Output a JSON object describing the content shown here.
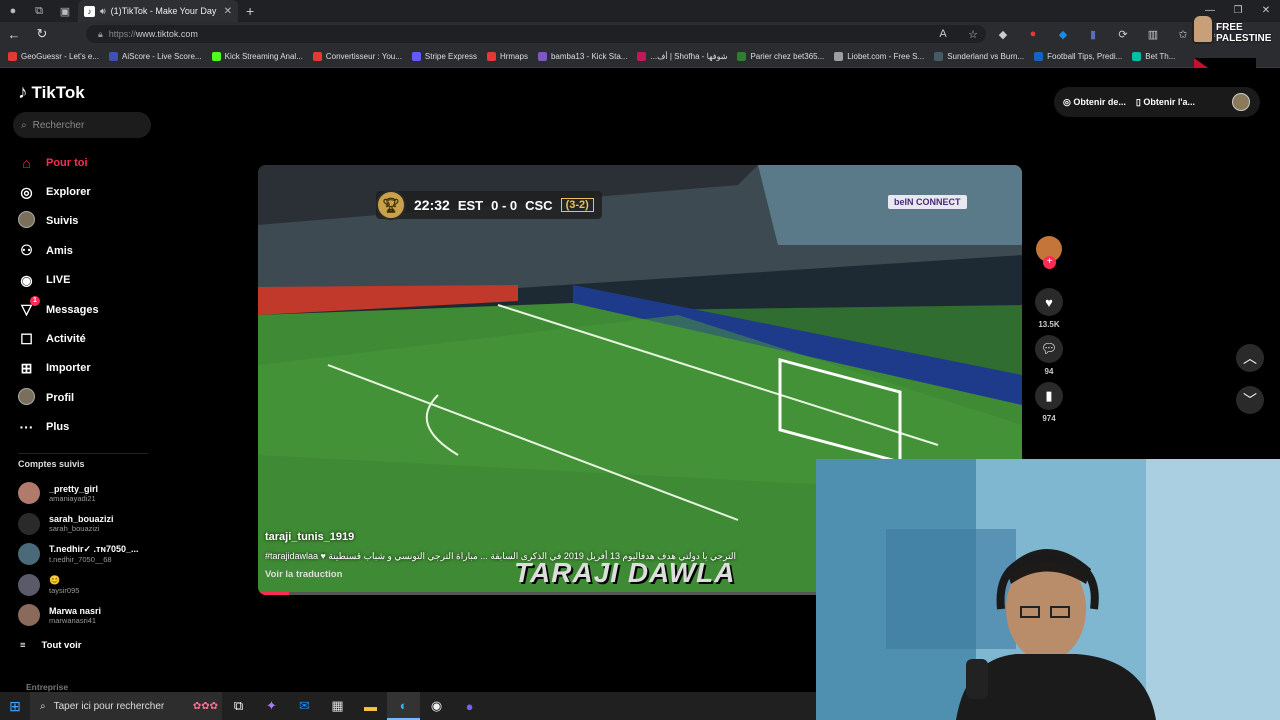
{
  "browser": {
    "tab_title": "(1)TikTok - Make Your Day",
    "url_prefix": "https://",
    "url": "www.tiktok.com",
    "bookmarks": [
      {
        "label": "GeoGuessr - Let's e...",
        "color": "#e53935"
      },
      {
        "label": "AiScore - Live Score...",
        "color": "#3f51b5"
      },
      {
        "label": "Kick Streaming Anal...",
        "color": "#53fc18"
      },
      {
        "label": "Convertisseur : You...",
        "color": "#e53935"
      },
      {
        "label": "Stripe Express",
        "color": "#635bff"
      },
      {
        "label": "Hrmaps",
        "color": "#e53935"
      },
      {
        "label": "bamba13 - Kick Sta...",
        "color": "#7e57c2"
      },
      {
        "label": "...أف | Shofha - شوفها",
        "color": "#c2185b"
      },
      {
        "label": "Parier chez bet365...",
        "color": "#2e7d32"
      },
      {
        "label": "Liobet.com - Free S...",
        "color": "#9e9e9e"
      },
      {
        "label": "Sunderland vs Burn...",
        "color": "#455a64"
      },
      {
        "label": "Football Tips, Predi...",
        "color": "#1565c0"
      },
      {
        "label": "Bet Th...",
        "color": "#00bfa5"
      }
    ],
    "overlay_text": "FREE PALESTINE"
  },
  "tiktok": {
    "logo": "TikTok",
    "search_placeholder": "Rechercher",
    "menu": [
      {
        "label": "Pour toi",
        "icon": "home-icon",
        "active": true
      },
      {
        "label": "Explorer",
        "icon": "compass-icon"
      },
      {
        "label": "Suivis",
        "icon": "avatar"
      },
      {
        "label": "Amis",
        "icon": "friends-icon"
      },
      {
        "label": "LIVE",
        "icon": "live-icon"
      },
      {
        "label": "Messages",
        "icon": "messages-icon",
        "badge": "1"
      },
      {
        "label": "Activité",
        "icon": "activity-icon"
      },
      {
        "label": "Importer",
        "icon": "upload-icon"
      },
      {
        "label": "Profil",
        "icon": "avatar"
      },
      {
        "label": "Plus",
        "icon": "more-icon"
      }
    ],
    "followed_header": "Comptes suivis",
    "followed": [
      {
        "name": "_pretty_girl",
        "handle": "amaniayadi21",
        "color": "#b07b6a"
      },
      {
        "name": "sarah_bouazizi",
        "handle": "sarah_bouazizi",
        "color": "#2a2a2a"
      },
      {
        "name": "T.nedhir✓ .тɴ7050_...",
        "handle": "t.nedhir_7050__68",
        "color": "#4a6a7a"
      },
      {
        "name": "😊",
        "handle": "taysir095",
        "color": "#5a5a6a"
      },
      {
        "name": "Marwa nasri",
        "handle": "marwanasri41",
        "color": "#8a6a5a"
      }
    ],
    "see_all": "Tout voir",
    "entreprise": "Entreprise",
    "get_app": "Obtenir de...",
    "get_app2": "Obtenir l'a..."
  },
  "video": {
    "scoreboard": {
      "clock": "22:32",
      "home": "EST",
      "score": "0 - 0",
      "away": "CSC",
      "aggregate": "(3-2)"
    },
    "broadcaster": "beIN CONNECT",
    "author": "taraji_tunis_1919",
    "description": "#tarajidawlaa ♥ الترجي يا دولتي هدف هدفاليوم 13 أفريل 2019 في الذكرى السابقة ... مباراة الترجي التونسي و شباب قسنطينة",
    "translate": "Voir la traduction",
    "watermark": "TARAJI DAWLA",
    "progress": 0.04
  },
  "actions": {
    "likes": "13.5K",
    "comments": "94",
    "saves": "974"
  },
  "taskbar": {
    "search_placeholder": "Taper ici pour rechercher"
  }
}
